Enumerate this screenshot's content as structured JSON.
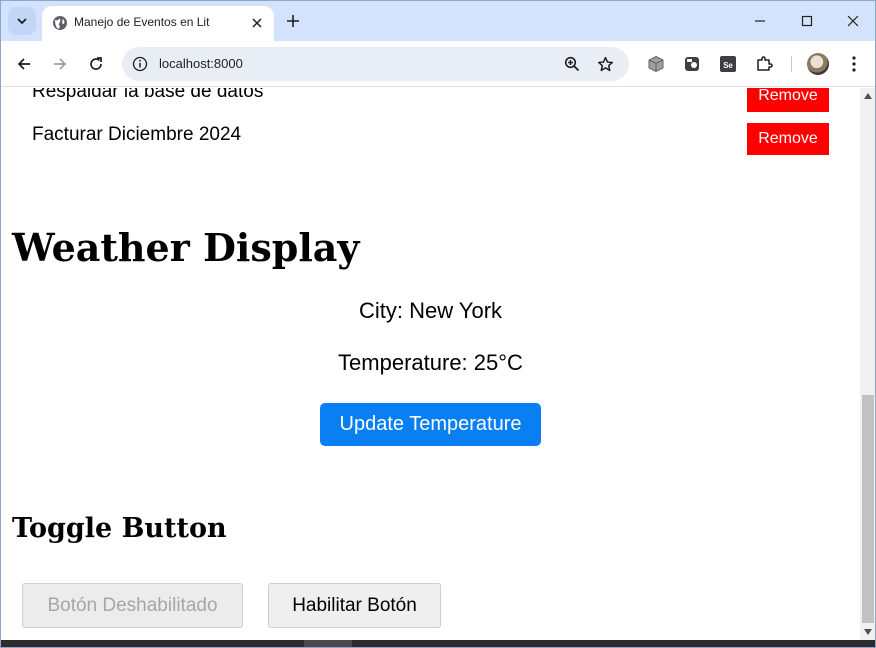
{
  "browser": {
    "tab": {
      "title": "Manejo de Eventos en Lit"
    },
    "address": {
      "url": "localhost:8000"
    }
  },
  "todos": {
    "items": [
      {
        "text": "Respaldar la base de datos"
      },
      {
        "text": "Facturar Diciembre 2024"
      }
    ],
    "remove_label": "Remove"
  },
  "weather": {
    "heading": "Weather Display",
    "city": "City: New York",
    "temperature": "Temperature: 25°C",
    "update_label": "Update Temperature"
  },
  "toggle": {
    "heading": "Toggle Button",
    "disabled_label": "Botón Deshabilitado",
    "enable_label": "Habilitar Botón"
  },
  "colors": {
    "remove": "#ff0000",
    "update": "#0a7ef3",
    "tabstrip": "#d3e3fd"
  },
  "scroll": {
    "position_fraction": 0.6
  }
}
